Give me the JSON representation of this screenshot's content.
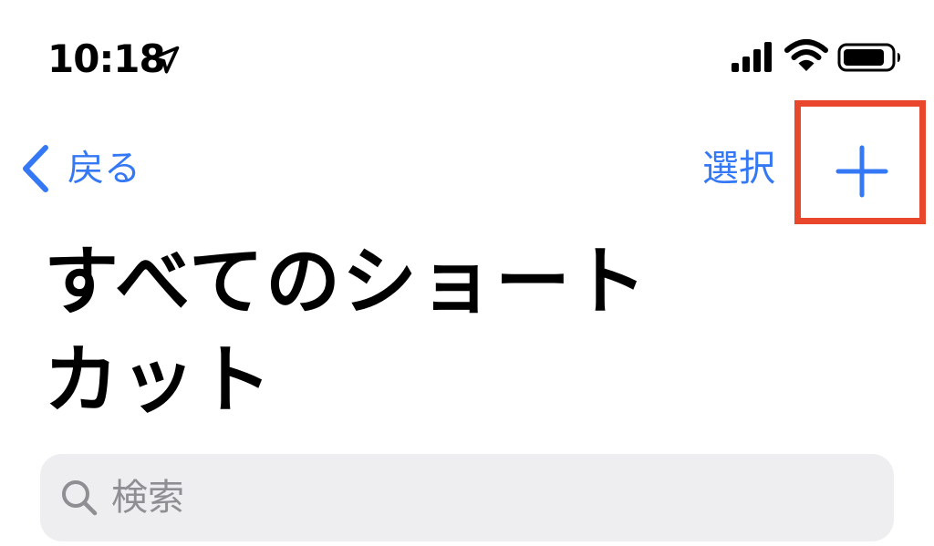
{
  "status_bar": {
    "time": "10:18",
    "icons": [
      "location-arrow-icon",
      "cellular-signal-icon",
      "wifi-icon",
      "battery-icon"
    ]
  },
  "nav": {
    "back_label": "戻る",
    "select_label": "選択",
    "add_icon": "plus-icon"
  },
  "page": {
    "title_line1": "すべてのショート",
    "title_line2": "カット"
  },
  "search": {
    "placeholder": "検索"
  },
  "colors": {
    "accent": "#3478f6",
    "highlight": "#e8472c",
    "search_bg": "#eeeef0",
    "placeholder": "#8e8e93"
  }
}
